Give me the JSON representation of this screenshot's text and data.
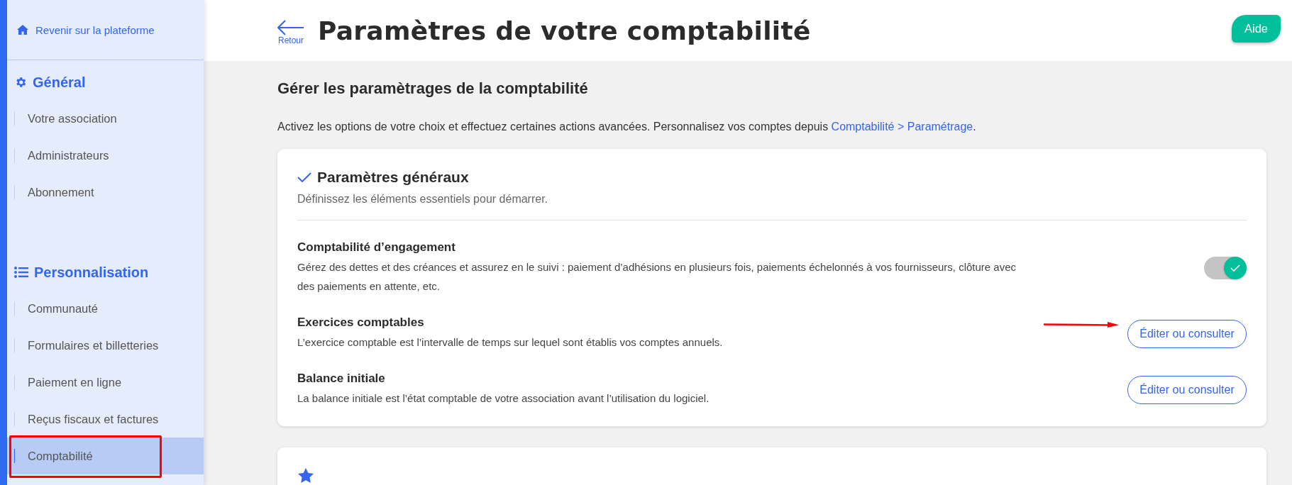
{
  "sidebar": {
    "back_link": "Revenir sur la plateforme",
    "sections": [
      {
        "kind": "gear",
        "title": "Général",
        "items": [
          {
            "label": "Votre association",
            "selected": false
          },
          {
            "label": "Administrateurs",
            "selected": false
          },
          {
            "label": "Abonnement",
            "selected": false
          }
        ]
      },
      {
        "kind": "list",
        "title": "Personnalisation",
        "items": [
          {
            "label": "Communauté",
            "selected": false
          },
          {
            "label": "Formulaires et billetteries",
            "selected": false
          },
          {
            "label": "Paiement en ligne",
            "selected": false
          },
          {
            "label": "Reçus fiscaux et factures",
            "selected": false
          },
          {
            "label": "Comptabilité",
            "selected": true,
            "annotation_frame": true
          }
        ]
      }
    ]
  },
  "header": {
    "back_label": "Retour",
    "title": "Paramètres de votre comptabilité",
    "help_button": "Aide"
  },
  "main": {
    "heading": "Gérer les paramètrages de la comptabilité",
    "intro": "Activez les options de votre choix et effectuez certaines actions avancées. Personnalisez vos comptes depuis ",
    "intro_link": "Comptabilité > Paramétrage",
    "intro_end": "."
  },
  "cards": [
    {
      "kind": "check",
      "title": "Paramètres généraux",
      "subtitle": "Définissez les éléments essentiels pour démarrer.",
      "rows": [
        {
          "kind": "toggle",
          "title": "Comptabilité d’engagement",
          "description": "Gérez des dettes et des créances et assurez en le suivi : paiement d’adhésions en plusieurs fois, paiements échelonnés à vos fournisseurs, clôture avec des paiements en attente, etc.",
          "on": true
        },
        {
          "kind": "button",
          "title": "Exercices comptables",
          "description": "L’exercice comptable est l’intervalle de temps sur lequel sont établis vos comptes annuels.",
          "button": "Éditer ou consulter",
          "annotation_arrow": true
        },
        {
          "kind": "button",
          "title": "Balance initiale",
          "description": "La balance initiale est l’état comptable de votre association avant l’utilisation du logiciel.",
          "button": "Éditer ou consulter"
        }
      ]
    },
    {
      "kind": "star"
    }
  ]
}
